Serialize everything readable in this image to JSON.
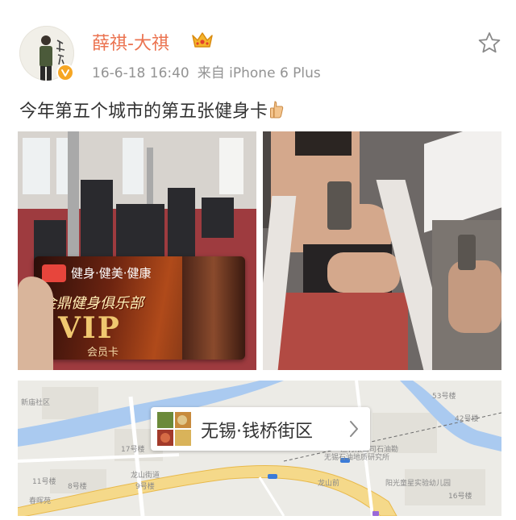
{
  "post": {
    "author": {
      "name": "薛祺-大祺",
      "verified_badge_color": "#f6a623",
      "crown_icon": "crown-icon"
    },
    "date": "16-6-18 16:40",
    "source": "来自 iPhone 6 Plus",
    "text": "今年第五个城市的第五张健身卡",
    "emoji_icon": "thumbs-up-icon"
  },
  "photos": [
    {
      "card": {
        "tagline": "健身·健美·健康",
        "club": "金鼎健身俱乐部",
        "tier": "VIP",
        "member": "会员卡"
      }
    },
    {}
  ],
  "location": {
    "name": "无锡·钱桥街区"
  },
  "map": {
    "labels": [
      "新庙社区",
      "龙山街道",
      "17号楼",
      "8号楼",
      "9号楼",
      "11号楼",
      "春晖苑",
      "龙山前",
      "阳光童星实验幼儿园",
      "16号楼",
      "42号楼",
      "53号楼",
      "渔有限公司石油勘",
      "无锡石油地质研究所"
    ]
  },
  "colors": {
    "accent": "#eb7350",
    "secondary_text": "#939393",
    "primary_text": "#333333"
  }
}
